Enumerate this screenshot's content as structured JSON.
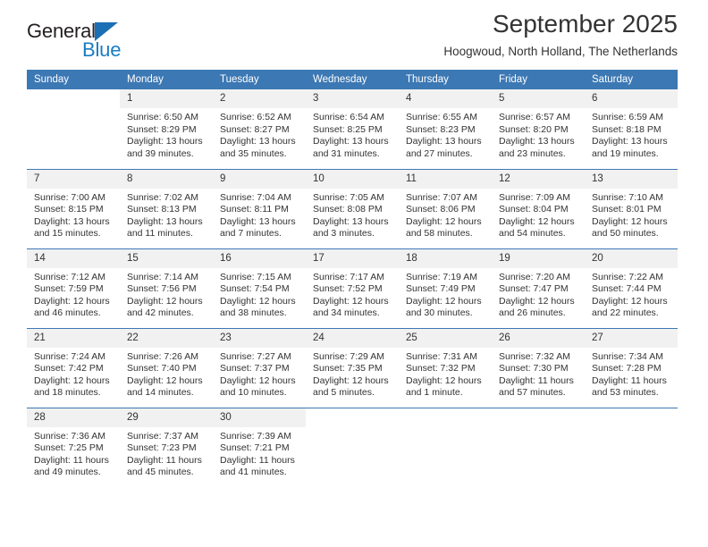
{
  "brand": {
    "name_part1": "General",
    "name_part2": "Blue",
    "triangle_icon": "blue-triangle-icon",
    "accent_color": "#1a7cc4"
  },
  "header": {
    "title": "September 2025",
    "subtitle": "Hoogwoud, North Holland, The Netherlands"
  },
  "calendar": {
    "header_bg": "#3c78b4",
    "daynum_bg": "#f1f1f1",
    "weekday_headers": [
      "Sunday",
      "Monday",
      "Tuesday",
      "Wednesday",
      "Thursday",
      "Friday",
      "Saturday"
    ],
    "weeks": [
      [
        {
          "day": "",
          "sunrise": "",
          "sunset": "",
          "daylight": ""
        },
        {
          "day": "1",
          "sunrise": "Sunrise: 6:50 AM",
          "sunset": "Sunset: 8:29 PM",
          "daylight": "Daylight: 13 hours and 39 minutes."
        },
        {
          "day": "2",
          "sunrise": "Sunrise: 6:52 AM",
          "sunset": "Sunset: 8:27 PM",
          "daylight": "Daylight: 13 hours and 35 minutes."
        },
        {
          "day": "3",
          "sunrise": "Sunrise: 6:54 AM",
          "sunset": "Sunset: 8:25 PM",
          "daylight": "Daylight: 13 hours and 31 minutes."
        },
        {
          "day": "4",
          "sunrise": "Sunrise: 6:55 AM",
          "sunset": "Sunset: 8:23 PM",
          "daylight": "Daylight: 13 hours and 27 minutes."
        },
        {
          "day": "5",
          "sunrise": "Sunrise: 6:57 AM",
          "sunset": "Sunset: 8:20 PM",
          "daylight": "Daylight: 13 hours and 23 minutes."
        },
        {
          "day": "6",
          "sunrise": "Sunrise: 6:59 AM",
          "sunset": "Sunset: 8:18 PM",
          "daylight": "Daylight: 13 hours and 19 minutes."
        }
      ],
      [
        {
          "day": "7",
          "sunrise": "Sunrise: 7:00 AM",
          "sunset": "Sunset: 8:15 PM",
          "daylight": "Daylight: 13 hours and 15 minutes."
        },
        {
          "day": "8",
          "sunrise": "Sunrise: 7:02 AM",
          "sunset": "Sunset: 8:13 PM",
          "daylight": "Daylight: 13 hours and 11 minutes."
        },
        {
          "day": "9",
          "sunrise": "Sunrise: 7:04 AM",
          "sunset": "Sunset: 8:11 PM",
          "daylight": "Daylight: 13 hours and 7 minutes."
        },
        {
          "day": "10",
          "sunrise": "Sunrise: 7:05 AM",
          "sunset": "Sunset: 8:08 PM",
          "daylight": "Daylight: 13 hours and 3 minutes."
        },
        {
          "day": "11",
          "sunrise": "Sunrise: 7:07 AM",
          "sunset": "Sunset: 8:06 PM",
          "daylight": "Daylight: 12 hours and 58 minutes."
        },
        {
          "day": "12",
          "sunrise": "Sunrise: 7:09 AM",
          "sunset": "Sunset: 8:04 PM",
          "daylight": "Daylight: 12 hours and 54 minutes."
        },
        {
          "day": "13",
          "sunrise": "Sunrise: 7:10 AM",
          "sunset": "Sunset: 8:01 PM",
          "daylight": "Daylight: 12 hours and 50 minutes."
        }
      ],
      [
        {
          "day": "14",
          "sunrise": "Sunrise: 7:12 AM",
          "sunset": "Sunset: 7:59 PM",
          "daylight": "Daylight: 12 hours and 46 minutes."
        },
        {
          "day": "15",
          "sunrise": "Sunrise: 7:14 AM",
          "sunset": "Sunset: 7:56 PM",
          "daylight": "Daylight: 12 hours and 42 minutes."
        },
        {
          "day": "16",
          "sunrise": "Sunrise: 7:15 AM",
          "sunset": "Sunset: 7:54 PM",
          "daylight": "Daylight: 12 hours and 38 minutes."
        },
        {
          "day": "17",
          "sunrise": "Sunrise: 7:17 AM",
          "sunset": "Sunset: 7:52 PM",
          "daylight": "Daylight: 12 hours and 34 minutes."
        },
        {
          "day": "18",
          "sunrise": "Sunrise: 7:19 AM",
          "sunset": "Sunset: 7:49 PM",
          "daylight": "Daylight: 12 hours and 30 minutes."
        },
        {
          "day": "19",
          "sunrise": "Sunrise: 7:20 AM",
          "sunset": "Sunset: 7:47 PM",
          "daylight": "Daylight: 12 hours and 26 minutes."
        },
        {
          "day": "20",
          "sunrise": "Sunrise: 7:22 AM",
          "sunset": "Sunset: 7:44 PM",
          "daylight": "Daylight: 12 hours and 22 minutes."
        }
      ],
      [
        {
          "day": "21",
          "sunrise": "Sunrise: 7:24 AM",
          "sunset": "Sunset: 7:42 PM",
          "daylight": "Daylight: 12 hours and 18 minutes."
        },
        {
          "day": "22",
          "sunrise": "Sunrise: 7:26 AM",
          "sunset": "Sunset: 7:40 PM",
          "daylight": "Daylight: 12 hours and 14 minutes."
        },
        {
          "day": "23",
          "sunrise": "Sunrise: 7:27 AM",
          "sunset": "Sunset: 7:37 PM",
          "daylight": "Daylight: 12 hours and 10 minutes."
        },
        {
          "day": "24",
          "sunrise": "Sunrise: 7:29 AM",
          "sunset": "Sunset: 7:35 PM",
          "daylight": "Daylight: 12 hours and 5 minutes."
        },
        {
          "day": "25",
          "sunrise": "Sunrise: 7:31 AM",
          "sunset": "Sunset: 7:32 PM",
          "daylight": "Daylight: 12 hours and 1 minute."
        },
        {
          "day": "26",
          "sunrise": "Sunrise: 7:32 AM",
          "sunset": "Sunset: 7:30 PM",
          "daylight": "Daylight: 11 hours and 57 minutes."
        },
        {
          "day": "27",
          "sunrise": "Sunrise: 7:34 AM",
          "sunset": "Sunset: 7:28 PM",
          "daylight": "Daylight: 11 hours and 53 minutes."
        }
      ],
      [
        {
          "day": "28",
          "sunrise": "Sunrise: 7:36 AM",
          "sunset": "Sunset: 7:25 PM",
          "daylight": "Daylight: 11 hours and 49 minutes."
        },
        {
          "day": "29",
          "sunrise": "Sunrise: 7:37 AM",
          "sunset": "Sunset: 7:23 PM",
          "daylight": "Daylight: 11 hours and 45 minutes."
        },
        {
          "day": "30",
          "sunrise": "Sunrise: 7:39 AM",
          "sunset": "Sunset: 7:21 PM",
          "daylight": "Daylight: 11 hours and 41 minutes."
        },
        {
          "day": "",
          "sunrise": "",
          "sunset": "",
          "daylight": ""
        },
        {
          "day": "",
          "sunrise": "",
          "sunset": "",
          "daylight": ""
        },
        {
          "day": "",
          "sunrise": "",
          "sunset": "",
          "daylight": ""
        },
        {
          "day": "",
          "sunrise": "",
          "sunset": "",
          "daylight": ""
        }
      ]
    ]
  }
}
